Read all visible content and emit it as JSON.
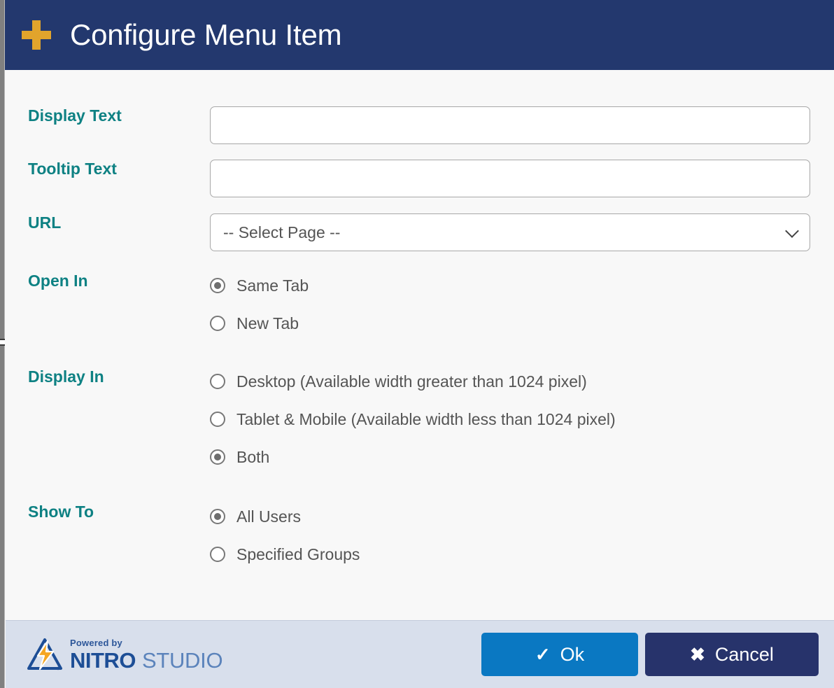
{
  "window": {
    "title": "Configure Menu Item",
    "title_icon": "plus-icon",
    "header_bg": "#23386e",
    "icon_color": "#e2a42c"
  },
  "form": {
    "display_text": {
      "label": "Display Text",
      "value": "",
      "placeholder": ""
    },
    "tooltip_text": {
      "label": "Tooltip Text",
      "value": "",
      "placeholder": ""
    },
    "url": {
      "label": "URL",
      "selected": "-- Select Page --",
      "options": [
        "-- Select Page --"
      ]
    },
    "open_in": {
      "label": "Open In",
      "options": [
        {
          "label": "Same Tab",
          "selected": true
        },
        {
          "label": "New Tab",
          "selected": false
        }
      ]
    },
    "display_in": {
      "label": "Display In",
      "options": [
        {
          "label": "Desktop (Available width greater than 1024 pixel)",
          "selected": false
        },
        {
          "label": "Tablet & Mobile (Available width less than 1024 pixel)",
          "selected": false
        },
        {
          "label": "Both",
          "selected": true
        }
      ]
    },
    "show_to": {
      "label": "Show To",
      "options": [
        {
          "label": "All Users",
          "selected": true
        },
        {
          "label": "Specified Groups",
          "selected": false
        }
      ]
    },
    "label_color": "#0e8183"
  },
  "footer": {
    "logo": {
      "powered_by": "Powered by",
      "brand_primary": "NITRO",
      "brand_secondary": "STUDIO",
      "mark": "nitro-lightning-triangle-logo"
    },
    "ok_button": {
      "label": "Ok",
      "icon": "check-icon",
      "color": "#0a78c2"
    },
    "cancel_button": {
      "label": "Cancel",
      "icon": "close-icon",
      "color": "#27336b"
    },
    "background": "#d8dfec"
  }
}
